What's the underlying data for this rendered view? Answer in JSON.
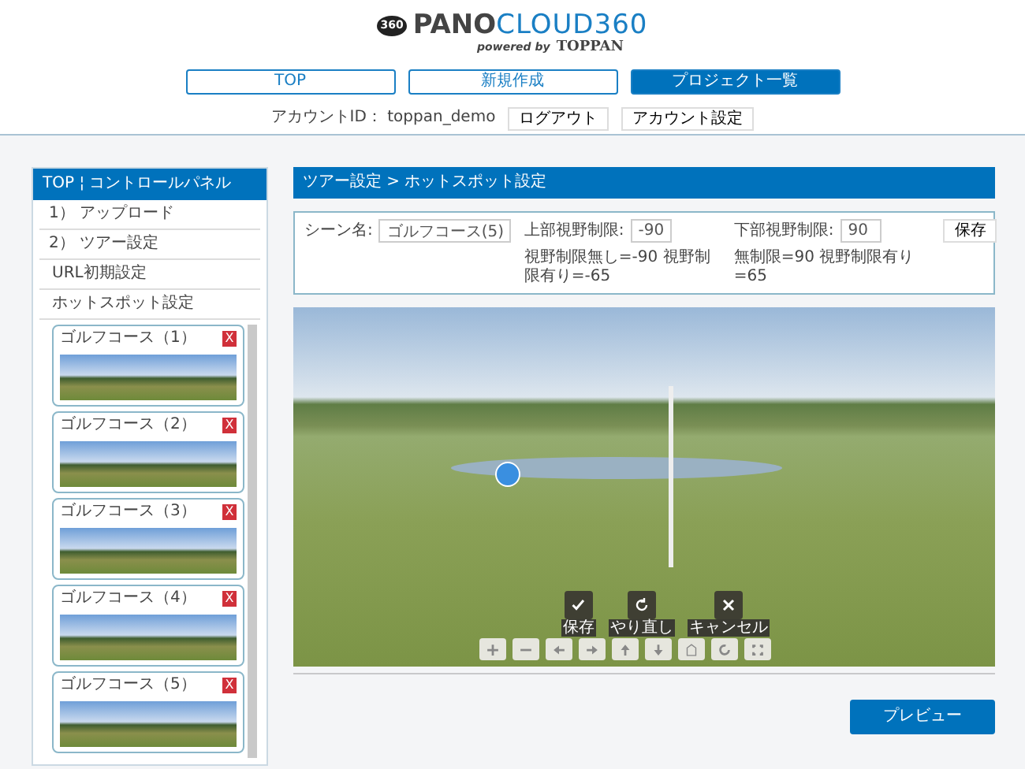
{
  "header": {
    "logo_badge": "360",
    "logo_bold": "PANO",
    "logo_light": "CLOUD360",
    "tagline": "powered by",
    "company": "TOPPAN"
  },
  "nav": [
    {
      "label": "TOP",
      "selected": false
    },
    {
      "label": "新規作成",
      "selected": false
    },
    {
      "label": "プロジェクト一覧",
      "selected": true
    }
  ],
  "account": {
    "label": "アカウントID：",
    "id": "toppan_demo",
    "buttons": [
      "ログアウト",
      "アカウント設定"
    ]
  },
  "sidebar": {
    "title": "TOP ¦ コントロールパネル",
    "items": [
      {
        "label": "1） アップロード",
        "kind": "section"
      },
      {
        "label": "2） ツアー設定",
        "kind": "section"
      },
      {
        "label": "URL初期設定",
        "kind": "sub"
      },
      {
        "label": "ホットスポット設定",
        "kind": "sub"
      }
    ],
    "scenes": [
      {
        "title": "ゴルフコース（1）",
        "delete": "X"
      },
      {
        "title": "ゴルフコース（2）",
        "delete": "X"
      },
      {
        "title": "ゴルフコース（3）",
        "delete": "X"
      },
      {
        "title": "ゴルフコース（4）",
        "delete": "X"
      },
      {
        "title": "ゴルフコース（5）",
        "delete": "X"
      }
    ]
  },
  "panel": {
    "breadcrumb": "ツアー設定 > ホットスポット設定",
    "scene_label": "シーン名:",
    "scene_name": "ゴルフコース(5)",
    "upper_label": "上部視野制限:",
    "upper_value": "-90",
    "upper_hint": "視野制限無し=-90 視野制限有り=-65",
    "lower_label": "下部視野制限:",
    "lower_value": "90",
    "lower_hint": "無制限=90 視野制限有り=65",
    "save": "保存"
  },
  "viewer": {
    "actions": [
      {
        "kind": "check",
        "label": "保存"
      },
      {
        "kind": "redo",
        "label": "やり直し"
      },
      {
        "kind": "cancel",
        "label": "キャンセル"
      }
    ],
    "tools": [
      {
        "kind": "plus"
      },
      {
        "kind": "minus"
      },
      {
        "kind": "left"
      },
      {
        "kind": "right"
      },
      {
        "kind": "up"
      },
      {
        "kind": "down"
      },
      {
        "kind": "home"
      },
      {
        "kind": "rotate"
      },
      {
        "kind": "fullscreen"
      }
    ]
  },
  "preview": "プレビュー"
}
